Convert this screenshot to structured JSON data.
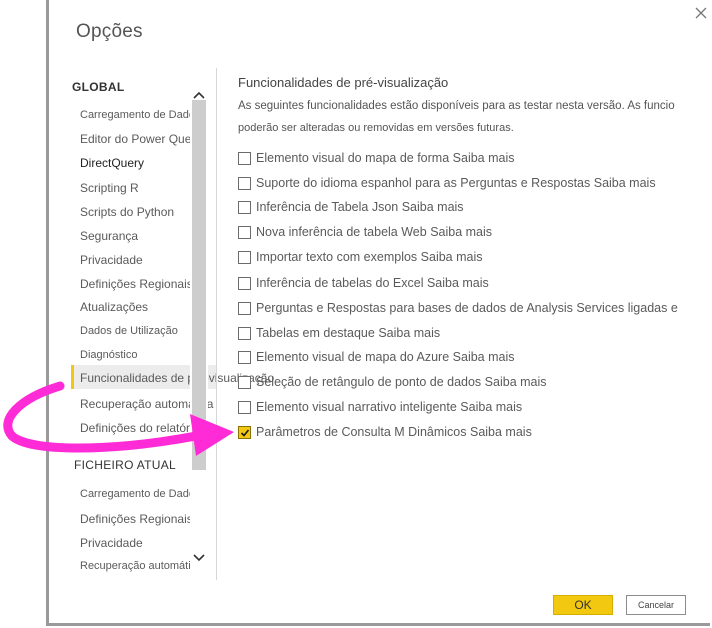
{
  "dialog": {
    "title": "Opções",
    "ok_label": "OK",
    "cancel_label": "Cancelar"
  },
  "nav": {
    "global_header": "GLOBAL",
    "global_items": [
      {
        "label": "Carregamento de Dados"
      },
      {
        "label": "Editor do Power Query"
      },
      {
        "label": "DirectQuery"
      },
      {
        "label": "Scripting R"
      },
      {
        "label": "Scripts do Python"
      },
      {
        "label": "Segurança"
      },
      {
        "label": "Privacidade"
      },
      {
        "label": "Definições Regionais"
      },
      {
        "label": "Atualizações"
      },
      {
        "label": "Dados de Utilização"
      },
      {
        "label": "Diagnóstico"
      },
      {
        "label": "Funcionalidades de pré-visualização"
      },
      {
        "label": "Recuperação automática"
      },
      {
        "label": "Definições do relatório"
      }
    ],
    "selected_index": 11,
    "file_header": "FICHEIRO ATUAL",
    "file_items": [
      {
        "label": "Carregamento de Dados"
      },
      {
        "label": "Definições Regionais"
      },
      {
        "label": "Privacidade"
      },
      {
        "label": "Recuperação automática"
      }
    ]
  },
  "content": {
    "title": "Funcionalidades de pré-visualização",
    "description_line1": "As seguintes funcionalidades estão disponíveis para as testar nesta versão. As funcio",
    "description_line2": "poderão ser alteradas ou removidas em versões futuras.",
    "features": [
      {
        "label": "Elemento visual do mapa de forma",
        "link": "Saiba mais",
        "checked": false
      },
      {
        "label": "Suporte do idioma espanhol para as Perguntas e Respostas",
        "link": "Saiba mais",
        "checked": false
      },
      {
        "label": "Inferência de Tabela Json",
        "link": "Saiba mais",
        "checked": false
      },
      {
        "label": "Nova inferência de tabela Web",
        "link": "Saiba mais",
        "checked": false
      },
      {
        "label": "Importar texto com exemplos",
        "link": "Saiba mais",
        "checked": false
      },
      {
        "label": "Inferência de tabelas do Excel",
        "link": "Saiba mais",
        "checked": false
      },
      {
        "label": "Perguntas  e  Respostas  para  bases  de  dados  de  Analysis  Services  ligadas  e",
        "link": "",
        "checked": false
      },
      {
        "label": "Tabelas em destaque",
        "link": "Saiba mais",
        "checked": false
      },
      {
        "label": "Elemento visual de mapa do Azure",
        "link": "Saiba mais",
        "checked": false
      },
      {
        "label": "Seleção de retângulo de ponto de dados",
        "link": "Saiba mais",
        "checked": false
      },
      {
        "label": "Elemento visual narrativo inteligente",
        "link": "Saiba mais",
        "checked": false
      },
      {
        "label": "Parâmetros de Consulta M Dinâmicos",
        "link": "Saiba mais",
        "checked": true
      }
    ]
  },
  "colors": {
    "accent": "#f2c811",
    "annotation_arrow": "#ff2bd6"
  },
  "icons": {
    "close": "close-icon",
    "scroll_up": "chevron-up-icon",
    "scroll_down": "chevron-down-icon",
    "check": "checkmark-icon"
  }
}
